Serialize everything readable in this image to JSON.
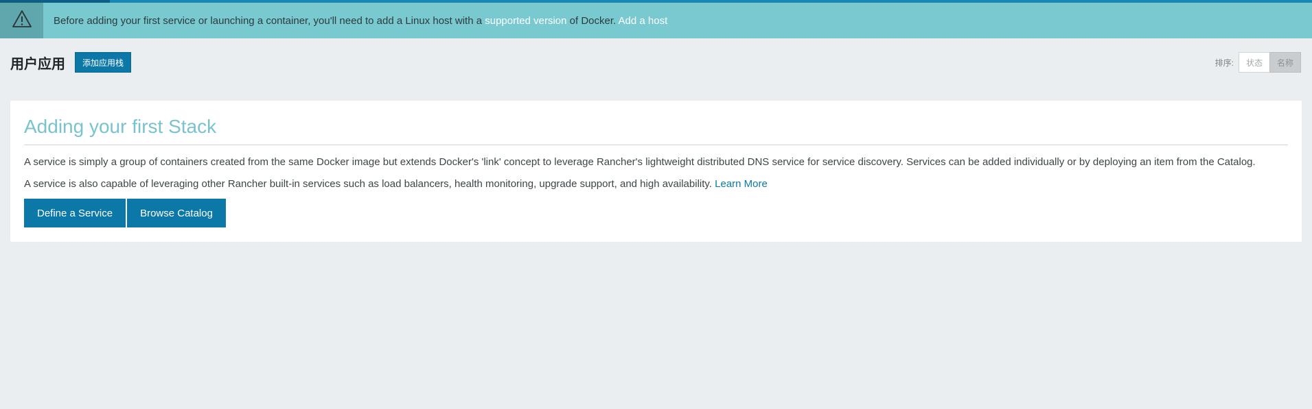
{
  "banner": {
    "icon": "warning-triangle-icon",
    "message_before": "Before adding your first service or launching a container, you'll need to add a Linux host with a ",
    "supported_version_link": "supported version",
    "message_after": " of Docker. ",
    "add_host_link": "Add a host"
  },
  "header": {
    "title": "用户应用",
    "add_stack_label": "添加应用栈"
  },
  "sort": {
    "label": "排序:",
    "options": [
      "状态",
      "名称"
    ],
    "selected": "名称"
  },
  "empty_state": {
    "title": "Adding your first Stack",
    "paragraph1": "A service is simply a group of containers created from the same Docker image but extends Docker's 'link' concept to leverage Rancher's lightweight distributed DNS service for service discovery. Services can be added individually or by deploying an item from the Catalog.",
    "paragraph2": "A service is also capable of leveraging other Rancher built-in services such as load balancers, health monitoring, upgrade support, and high availability. ",
    "learn_more_link": "Learn More",
    "define_service_label": "Define a Service",
    "browse_catalog_label": "Browse Catalog"
  },
  "colors": {
    "accent": "#0b78a8",
    "banner_bg": "#79c9d0",
    "banner_icon_bg": "#5fa6ad",
    "title_color": "#79c3cc",
    "page_bg": "#ebeef0"
  }
}
